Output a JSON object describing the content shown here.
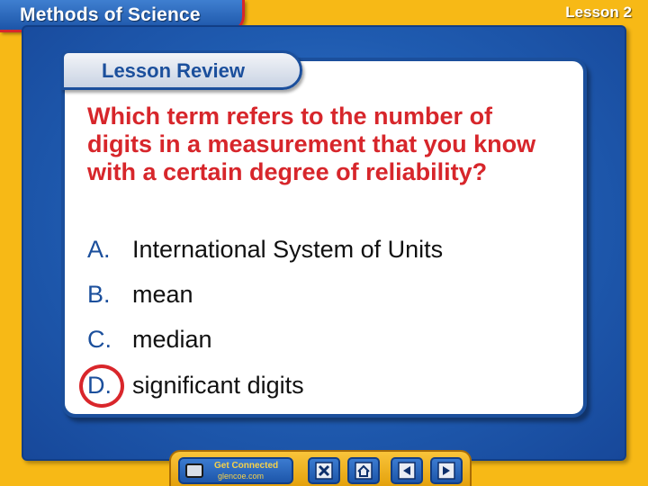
{
  "header": {
    "title": "Methods of Science",
    "lesson": "Lesson 2"
  },
  "review": {
    "title": "Lesson Review"
  },
  "question": {
    "text": "Which term refers to the number of digits in a measurement that you know with a certain degree of reliability?",
    "options": [
      {
        "letter": "A.",
        "text": "International System of Units"
      },
      {
        "letter": "B.",
        "text": "mean"
      },
      {
        "letter": "C.",
        "text": "median"
      },
      {
        "letter": "D.",
        "text": "significant digits"
      }
    ],
    "correct_option": "D."
  },
  "nav": {
    "get_connected_label": "Get Connected",
    "get_connected_sub": "glencoe.com",
    "buttons": [
      "close-icon",
      "home-icon",
      "previous-icon",
      "next-icon"
    ]
  },
  "colors": {
    "background": "#f7b916",
    "frame_blue": "#1f5bb0",
    "question_red": "#d7262b",
    "option_letter_blue": "#1b4f9c"
  }
}
